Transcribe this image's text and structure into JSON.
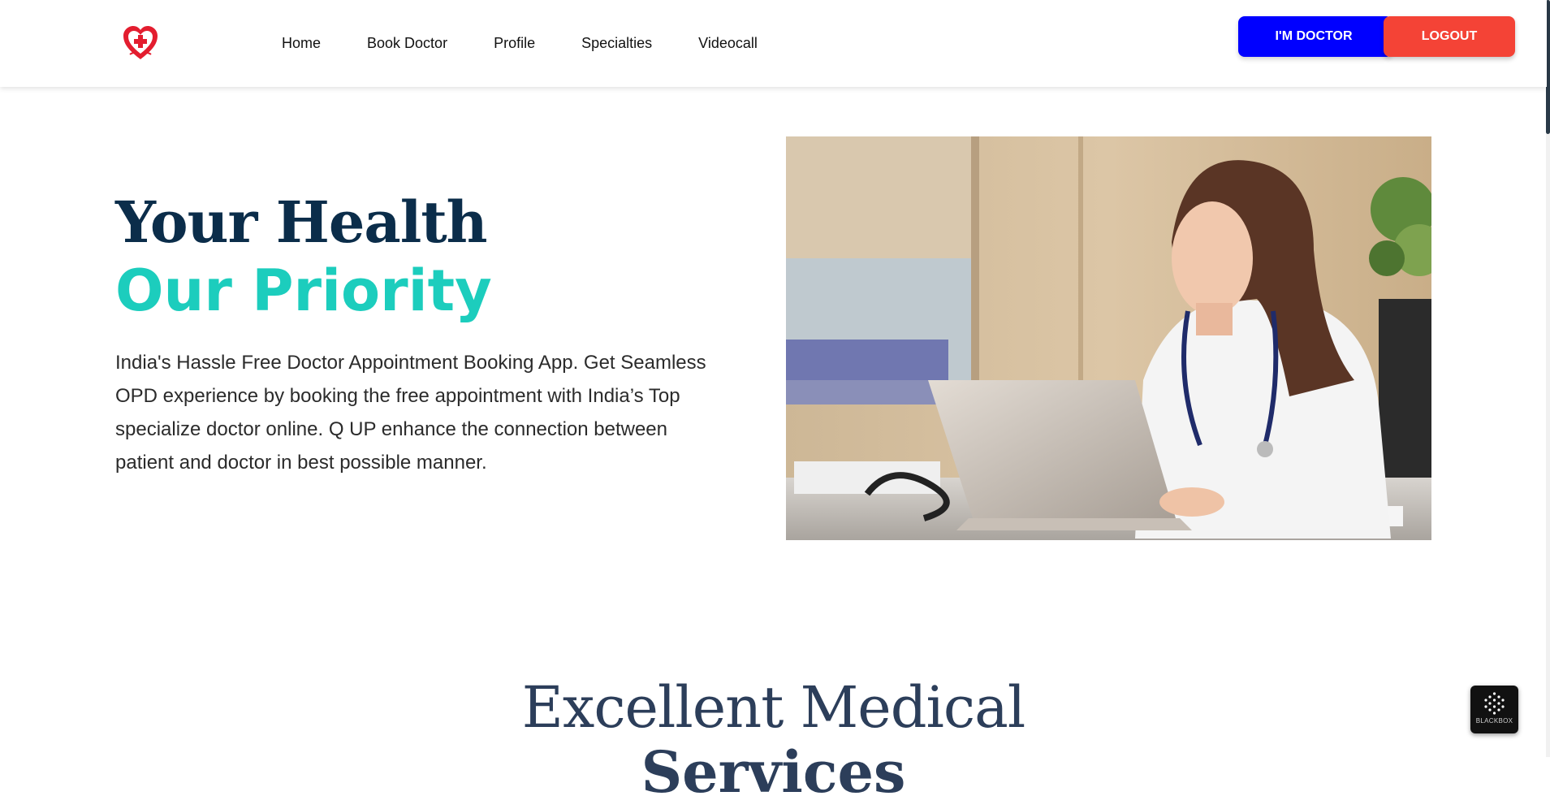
{
  "header": {
    "logo_icon": "heart-plus-icon",
    "nav": [
      "Home",
      "Book Doctor",
      "Profile",
      "Specialties",
      "Videocall"
    ],
    "doctor_button": "I'M DOCTOR",
    "logout_button": "LOGOUT",
    "colors": {
      "doctor": "#0000ff",
      "logout": "#f44336",
      "logo": "#e31d2f"
    }
  },
  "hero": {
    "title_line1": "Your Health",
    "title_line2": "Our Priority",
    "description": "India's Hassle Free Doctor Appointment Booking App. Get Seamless OPD experience by booking the free appointment with India’s Top specialize doctor online. Q UP enhance the connection between patient and doctor in best possible manner.",
    "colors": {
      "title1": "#0b2d4a",
      "title2": "#1ccdbd"
    }
  },
  "section": {
    "heading_line1": "Excellent Medical",
    "heading_line2": "Services"
  },
  "widget": {
    "label": "BLACKBOX",
    "icon": "blackbox-logo-icon"
  }
}
